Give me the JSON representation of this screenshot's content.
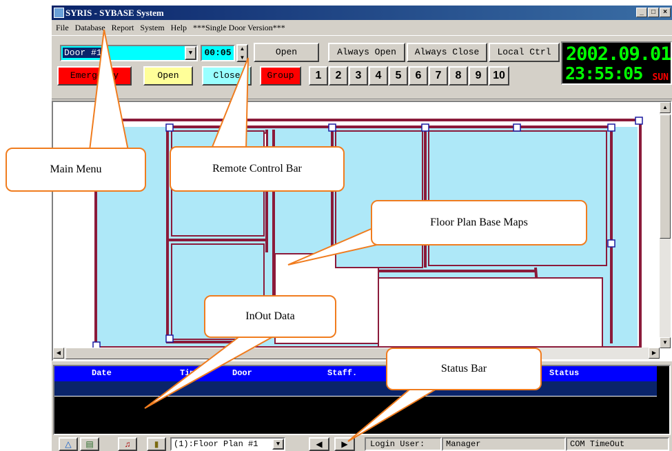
{
  "window": {
    "title": "SYRIS - SYBASE System",
    "min_label": "_",
    "max_label": "□",
    "close_label": "×"
  },
  "menu": {
    "items": [
      "File",
      "Database",
      "Report",
      "System",
      "Help"
    ],
    "version_note": "***Single Door Version***"
  },
  "control": {
    "door_select": "Door #1",
    "time_value": "00:05",
    "buttons": [
      "Open",
      "Always Open",
      "Always Close",
      "Local Ctrl"
    ],
    "emergency_label": "Emergency",
    "open_label": "Open",
    "close_label": "Close",
    "group_label": "Group",
    "numbers": [
      "1",
      "2",
      "3",
      "4",
      "5",
      "6",
      "7",
      "8",
      "9",
      "10"
    ]
  },
  "clock": {
    "date": "2002.09.01",
    "time": "23:55:05",
    "weekday": "SUN"
  },
  "table": {
    "columns": [
      "Date",
      "Time",
      "Door",
      "Staff.",
      "Status"
    ]
  },
  "statusbar": {
    "floor_select": "(1):Floor Plan #1",
    "login_label": "Login User:",
    "login_user": "Manager",
    "com_status": "COM TimeOut"
  },
  "callouts": {
    "main_menu": "Main Menu",
    "remote_control_bar": "Remote Control Bar",
    "floor_plan": "Floor Plan Base Maps",
    "inout_data": "InOut Data",
    "status_bar": "Status Bar"
  },
  "colors": {
    "emergency": "#ff0000",
    "open": "#ffff99",
    "close": "#99ffff",
    "group": "#ff0000",
    "clock_text": "#00ff00",
    "weekday_text": "#ff0000",
    "map_room": "#aee8f8",
    "map_wall": "#8b1a3a",
    "callout_border": "#f07c1e",
    "table_header": "#0000ff"
  },
  "icons": [
    "app-icon",
    "up-triangle-icon",
    "phone-icon",
    "bell-icon",
    "door-icon",
    "left-arrow-icon",
    "right-arrow-icon"
  ]
}
